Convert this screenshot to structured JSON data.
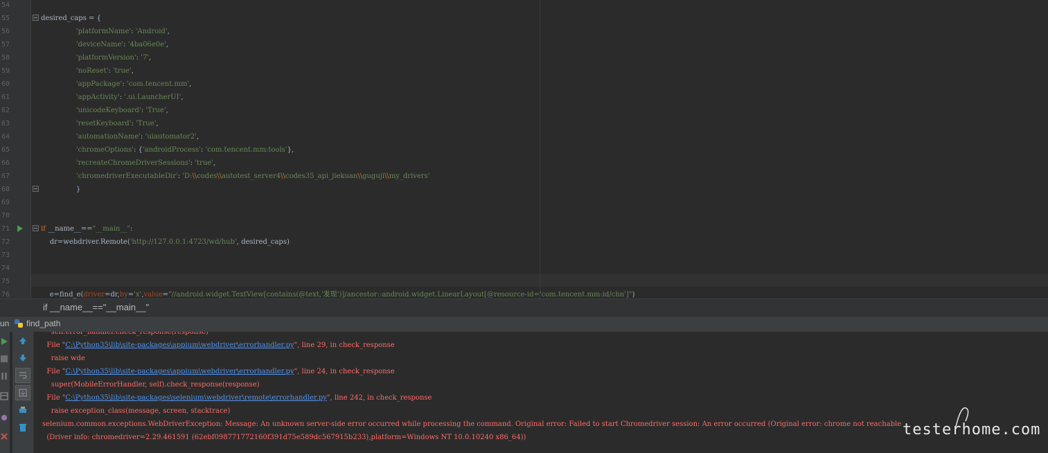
{
  "editor": {
    "lines": [
      {
        "n": "54",
        "text": ""
      },
      {
        "n": "55",
        "text": "desired_caps = {"
      },
      {
        "n": "56",
        "text": "                'platformName': 'Android',"
      },
      {
        "n": "57",
        "text": "                'deviceName': '4ba06e0e',"
      },
      {
        "n": "58",
        "text": "                'platformVersion': '7',"
      },
      {
        "n": "59",
        "text": "                'noReset': 'true',"
      },
      {
        "n": "60",
        "text": "                'appPackage': 'com.tencent.mm',"
      },
      {
        "n": "61",
        "text": "                'appActivity': '.ui.LauncherUI',"
      },
      {
        "n": "62",
        "text": "                'unicodeKeyboard': 'True',"
      },
      {
        "n": "63",
        "text": "                'resetKeyboard': 'True',"
      },
      {
        "n": "64",
        "text": "                'automationName': 'uiautomator2',"
      },
      {
        "n": "65",
        "text": "                'chromeOptions': {'androidProcess': 'com.tencent.mm:tools'},"
      },
      {
        "n": "66",
        "text": "                'recreateChromeDriverSessions': 'true',"
      },
      {
        "n": "67",
        "text": "                'chromedriverExecutableDir': 'D:\\\\codes\\\\autotest_server4\\\\codes35_api_jiekuan\\\\guguji\\\\my_drivers'"
      },
      {
        "n": "68",
        "text": "                }"
      },
      {
        "n": "69",
        "text": ""
      },
      {
        "n": "70",
        "text": ""
      },
      {
        "n": "71",
        "text": "if __name__==\"__main__\":"
      },
      {
        "n": "72",
        "text": "    dr=webdriver.Remote('http://127.0.0.1:4723/wd/hub', desired_caps)"
      },
      {
        "n": "73",
        "text": ""
      },
      {
        "n": "74",
        "text": ""
      },
      {
        "n": "75",
        "text": ""
      },
      {
        "n": "76",
        "text": "    e=find_e(driver=dr,by='x',value=\"//android.widget.TextView[contains(@text,'发现')]/ancestor::android.widget.LinearLayout[@resource-id='com.tencent.mm:id/chn']\")"
      }
    ]
  },
  "breadcrumb": "if __name__==\"__main__\"",
  "run_panel": {
    "label_prefix": "un",
    "config_name": "find_path"
  },
  "console": {
    "lines": [
      {
        "kind": "plain",
        "text": "    self.error_handler.check_response(response)"
      },
      {
        "kind": "file",
        "pre": "  File \"",
        "link": "C:\\Python35\\lib\\site-packages\\appium\\webdriver\\errorhandler.py",
        "post": "\", line 29, in check_response"
      },
      {
        "kind": "plain",
        "text": "    raise wde"
      },
      {
        "kind": "file",
        "pre": "  File \"",
        "link": "C:\\Python35\\lib\\site-packages\\appium\\webdriver\\errorhandler.py",
        "post": "\", line 24, in check_response"
      },
      {
        "kind": "plain",
        "text": "    super(MobileErrorHandler, self).check_response(response)"
      },
      {
        "kind": "file",
        "pre": "  File \"",
        "link": "C:\\Python35\\lib\\site-packages\\selenium\\webdriver\\remote\\errorhandler.py",
        "post": "\", line 242, in check_response"
      },
      {
        "kind": "plain",
        "text": "    raise exception_class(message, screen, stacktrace)"
      },
      {
        "kind": "plain",
        "text": "selenium.common.exceptions.WebDriverException: Message: An unknown server-side error occurred while processing the command. Original error: Failed to start Chromedriver session: An error occurred (Original error: chrome not reachable"
      },
      {
        "kind": "plain",
        "text": "  (Driver info: chromedriver=2.29.461591 (62ebf098771772160f391d75e589dc567915b233),platform=Windows NT 10.0.10240 x86_64))"
      }
    ]
  },
  "watermark": "testerhome.com",
  "colors": {
    "background": "#2b2b2b",
    "keyword": "#cc7832",
    "string": "#6a8759",
    "error": "#ff6b68",
    "link": "#5394ec"
  },
  "icons": [
    "fold-icon",
    "run-gutter-icon",
    "python-icon",
    "rerun-icon",
    "stop-icon",
    "pause-icon",
    "up-arrow-icon",
    "down-arrow-icon",
    "soft-wrap-icon",
    "scroll-end-icon",
    "print-icon",
    "trash-icon",
    "close-icon"
  ]
}
